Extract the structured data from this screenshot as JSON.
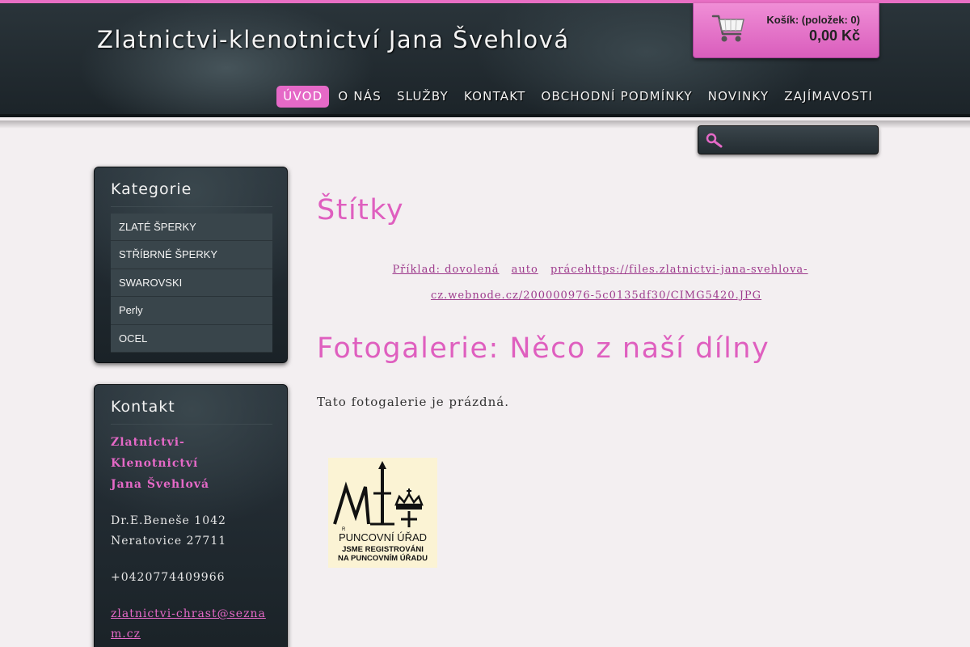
{
  "header": {
    "site_title": "Zlatnictvi-klenotnictví Jana Švehlová",
    "cart": {
      "count_label": "Košík: (položek: 0)",
      "total": "0,00 Kč"
    },
    "nav": [
      {
        "label": "ÚVOD",
        "active": true
      },
      {
        "label": "O NÁS",
        "active": false
      },
      {
        "label": "SLUŽBY",
        "active": false
      },
      {
        "label": "KONTAKT",
        "active": false
      },
      {
        "label": "OBCHODNÍ PODMÍNKY",
        "active": false
      },
      {
        "label": "NOVINKY",
        "active": false
      },
      {
        "label": "ZAJÍMAVOSTI",
        "active": false
      }
    ]
  },
  "search": {
    "value": "",
    "placeholder": ""
  },
  "sidebar": {
    "categories": {
      "title": "Kategorie",
      "items": [
        "ZLATÉ ŠPERKY",
        "STŘÍBRNÉ ŠPERKY",
        "SWAROVSKI",
        "Perly",
        "OCEL"
      ]
    },
    "contact": {
      "title": "Kontakt",
      "name_line1": "Zlatnictvi-Klenotnictví",
      "name_line2": "Jana Švehlová",
      "address_line1": "Dr.E.Beneše 1042",
      "address_line2": "Neratovice 27711",
      "phone": "+0420774409966",
      "email": "zlatnictvi-chrast@seznam.cz"
    }
  },
  "main": {
    "tags_title": "Štítky",
    "tags": [
      "Příklad: dovolená",
      "auto",
      "prácehttps://files.zlatnictvi-jana-svehlova-cz.webnode.cz/200000976-5c0135df30/CIMG5420.JPG"
    ],
    "gallery_title": "Fotogalerie: Něco z naší dílny",
    "gallery_empty": "Tato fotogalerie je prázdná.",
    "badge": {
      "line1": "PUNCOVNÍ ÚŘAD",
      "line2": "JSME REGISTROVÁNI",
      "line3": "NA PUNCOVNÍM ÚŘADU"
    }
  },
  "colors": {
    "accent": "#e569c7",
    "header_dark": "#1c2429",
    "background": "#f3eff1"
  }
}
